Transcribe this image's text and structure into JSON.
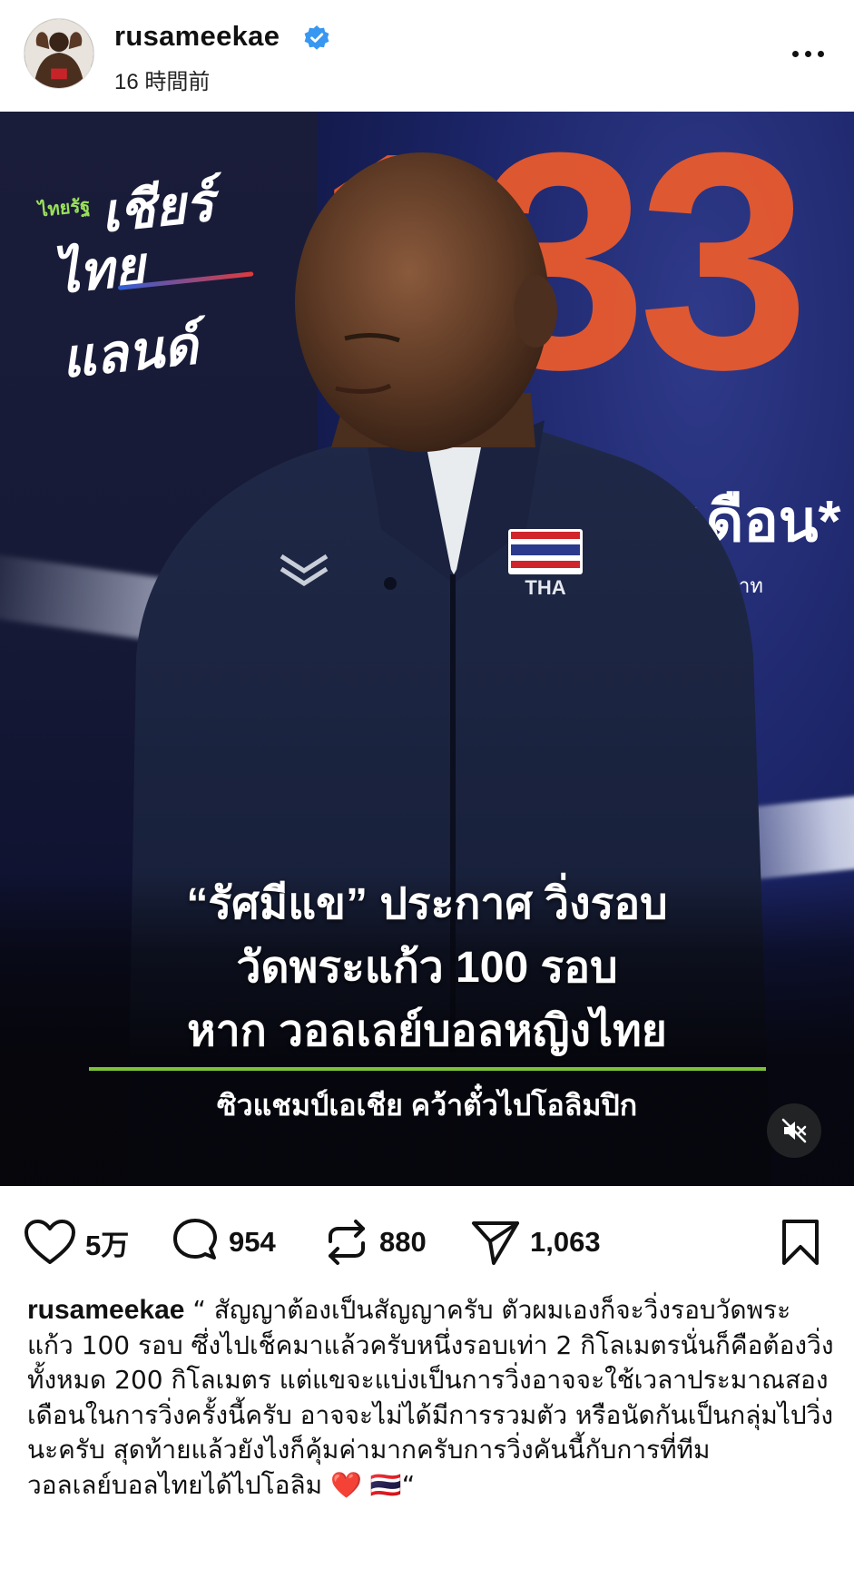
{
  "post": {
    "username": "rusameekae",
    "timestamp": "16 時間前",
    "verified": true
  },
  "media": {
    "logo_small": "ไทยรัฐ",
    "logo_line1": "เชียร์",
    "logo_line2": "ไทยแลนด์",
    "background_number": "133",
    "background_promo": "าท/เดือน*",
    "background_small": "บาท",
    "caption_line1": "“รัศมีแข” ประกาศ วิ่งรอบ",
    "caption_line2": "วัดพระแก้ว 100 รอบ",
    "caption_line3": "หาก วอลเลย์บอลหญิงไทย",
    "caption_subline": "ซิวแชมป์เอเชีย คว้าตั๋วไปโอลิมปิก",
    "jacket_patch": "THA",
    "muted": true
  },
  "actions": {
    "likes": "5万",
    "comments": "954",
    "reposts": "880",
    "shares": "1,063"
  },
  "caption": {
    "author": "rusameekae",
    "text": " “ สัญญาต้องเป็นสัญญาครับ ตัวผมเองก็จะวิ่งรอบวัดพระแก้ว 100 รอบ ซึ่งไปเช็คมาแล้วครับหนึ่งรอบเท่า 2 กิโลเมตรนั่นก็คือต้องวิ่งทั้งหมด 200 กิโลเมตร แต่แขจะแบ่งเป็นการวิ่งอาจจะใช้เวลาประมาณสองเดือนในการวิ่งครั้งนี้ครับ อาจจะไม่ได้มีการรวมตัว หรือนัดกันเป็นกลุ่มไปวิ่งนะครับ สุดท้ายแล้วยังไงก็คุ้มค่ามากครับการวิ่งคันนี้กับการที่ทีมวอลเลย์บอลไทยได้ไปโอลิม ",
    "emoji_heart": "❤️",
    "emoji_flag": "🇹🇭",
    "closing": "“"
  },
  "colors": {
    "verified_blue": "#3897f0",
    "accent_green": "#7cc23a",
    "number_orange": "#e85a2e"
  }
}
